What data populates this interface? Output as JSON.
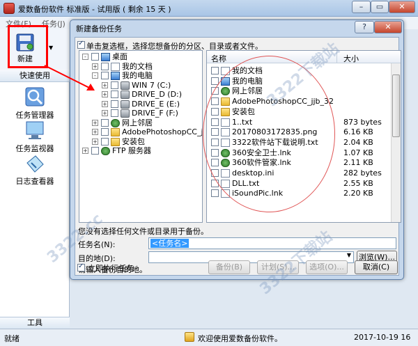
{
  "app": {
    "title": "爱数备份软件 标准版 - 试用版 ( 剩余 15 天 )",
    "minimize": "–",
    "restore": "▭",
    "close": "✕"
  },
  "menu": {
    "file": "文件(F)",
    "task": "任务(J)"
  },
  "toolbar": {
    "new_label": "新建",
    "arrow": "▼"
  },
  "left_panel": {
    "header": "快速使用",
    "items": [
      "任务管理器",
      "任务监视器",
      "日志查看器"
    ],
    "tools_tab": "工具"
  },
  "status": {
    "ready": "就绪",
    "welcome": "欢迎使用爱数备份软件。",
    "date": "2017-10-19 16"
  },
  "dialog": {
    "title": "新建备份任务",
    "help_close": "?",
    "close": "✕",
    "instruction": "单击复选框，选择您想备份的分区、目录或者文件。",
    "tree": [
      {
        "label": "桌面",
        "indent": 0,
        "exp": "-",
        "icon": "pc"
      },
      {
        "label": "我的文档",
        "indent": 1,
        "exp": "+",
        "icon": "doc"
      },
      {
        "label": "我的电脑",
        "indent": 1,
        "exp": "-",
        "icon": "pc"
      },
      {
        "label": "WIN 7 (C:)",
        "indent": 2,
        "exp": "+",
        "icon": "drive"
      },
      {
        "label": "DRIVE_D (D:)",
        "indent": 2,
        "exp": "+",
        "icon": "drive"
      },
      {
        "label": "DRIVE_E (E:)",
        "indent": 2,
        "exp": "+",
        "icon": "drive"
      },
      {
        "label": "DRIVE_F (F:)",
        "indent": 2,
        "exp": "+",
        "icon": "drive"
      },
      {
        "label": "网上邻居",
        "indent": 1,
        "exp": "+",
        "icon": "net"
      },
      {
        "label": "AdobePhotoshopCC_jjb_32",
        "indent": 1,
        "exp": "+",
        "icon": "folder"
      },
      {
        "label": "安装包",
        "indent": 1,
        "exp": "+",
        "icon": "folder"
      },
      {
        "label": "FTP 服务器",
        "indent": 0,
        "exp": "+",
        "icon": "net"
      }
    ],
    "list_headers": {
      "name": "名称",
      "size": "大小"
    },
    "list": [
      {
        "name": "我的文档",
        "size": "",
        "icon": "doc"
      },
      {
        "name": "我的电脑",
        "size": "",
        "icon": "pc"
      },
      {
        "name": "网上邻居",
        "size": "",
        "icon": "net"
      },
      {
        "name": "AdobePhotoshopCC_jjb_32",
        "size": "",
        "icon": "folder"
      },
      {
        "name": "安装包",
        "size": "",
        "icon": "folder"
      },
      {
        "name": "1..txt",
        "size": "873 bytes",
        "icon": "doc"
      },
      {
        "name": "20170803172835.png",
        "size": "6.16 KB",
        "icon": "doc"
      },
      {
        "name": "3322软件站下载说明.txt",
        "size": "2.04 KB",
        "icon": "doc"
      },
      {
        "name": "360安全卫士.lnk",
        "size": "1.07 KB",
        "icon": "net"
      },
      {
        "name": "360软件管家.lnk",
        "size": "2.11 KB",
        "icon": "net"
      },
      {
        "name": "desktop.ini",
        "size": "282 bytes",
        "icon": "doc"
      },
      {
        "name": "DLL.txt",
        "size": "2.55 KB",
        "icon": "doc"
      },
      {
        "name": "iSoundPic.lnk",
        "size": "2.20 KB",
        "icon": "doc"
      }
    ],
    "hint": "您没有选择任何文件或目录用于备份。",
    "task_name_label": "任务名(N):",
    "task_name_value": "<任务名>",
    "dest_label": "目的地(D):",
    "dest_hint": "请输入备份目的地。",
    "browse": "浏览(W)...",
    "run_now": "立即执行任务",
    "buttons": {
      "backup": "备份(B)",
      "plan": "计划(S)...",
      "options": "选项(O)...",
      "cancel": "取消(C)"
    }
  },
  "watermarks": [
    "3322下载站",
    "3322.cc"
  ]
}
